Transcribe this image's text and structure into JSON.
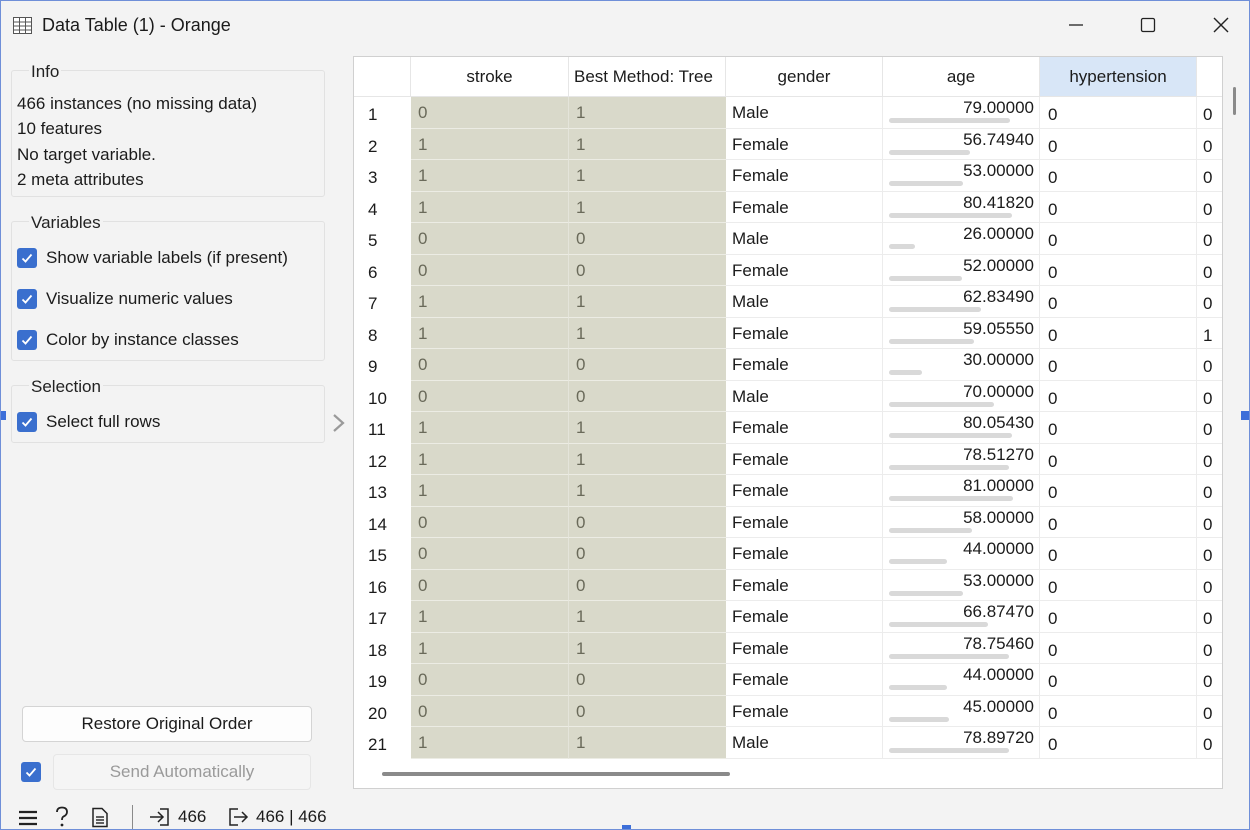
{
  "window": {
    "title": "Data Table (1) - Orange",
    "icon": "table-icon",
    "controls": [
      "minimize-icon",
      "maximize-icon",
      "close-icon"
    ]
  },
  "info": {
    "heading": "Info",
    "lines": [
      "466 instances (no missing data)",
      "10 features",
      "No target variable.",
      "2 meta attributes"
    ]
  },
  "variables": {
    "heading": "Variables",
    "options": [
      {
        "label": "Show variable labels (if present)",
        "checked": true
      },
      {
        "label": "Visualize numeric values",
        "checked": true
      },
      {
        "label": "Color by instance classes",
        "checked": true
      }
    ]
  },
  "selection": {
    "heading": "Selection",
    "options": [
      {
        "label": "Select full rows",
        "checked": true
      }
    ]
  },
  "buttons": {
    "restore": "Restore Original Order",
    "send": "Send Automatically",
    "send_auto_checked": true
  },
  "table": {
    "columns": [
      "stroke",
      "Best Method: Tree",
      "gender",
      "age",
      "hypertension"
    ],
    "selected_column": "hypertension",
    "age_max": 82,
    "rows": [
      {
        "idx": "1",
        "stroke": "0",
        "best": "1",
        "gender": "Male",
        "age": "79.00000",
        "hyp": "0",
        "next": "0"
      },
      {
        "idx": "2",
        "stroke": "1",
        "best": "1",
        "gender": "Female",
        "age": "56.74940",
        "hyp": "0",
        "next": "0"
      },
      {
        "idx": "3",
        "stroke": "1",
        "best": "1",
        "gender": "Female",
        "age": "53.00000",
        "hyp": "0",
        "next": "0"
      },
      {
        "idx": "4",
        "stroke": "1",
        "best": "1",
        "gender": "Female",
        "age": "80.41820",
        "hyp": "0",
        "next": "0"
      },
      {
        "idx": "5",
        "stroke": "0",
        "best": "0",
        "gender": "Male",
        "age": "26.00000",
        "hyp": "0",
        "next": "0"
      },
      {
        "idx": "6",
        "stroke": "0",
        "best": "0",
        "gender": "Female",
        "age": "52.00000",
        "hyp": "0",
        "next": "0"
      },
      {
        "idx": "7",
        "stroke": "1",
        "best": "1",
        "gender": "Male",
        "age": "62.83490",
        "hyp": "0",
        "next": "0"
      },
      {
        "idx": "8",
        "stroke": "1",
        "best": "1",
        "gender": "Female",
        "age": "59.05550",
        "hyp": "0",
        "next": "1"
      },
      {
        "idx": "9",
        "stroke": "0",
        "best": "0",
        "gender": "Female",
        "age": "30.00000",
        "hyp": "0",
        "next": "0"
      },
      {
        "idx": "10",
        "stroke": "0",
        "best": "0",
        "gender": "Male",
        "age": "70.00000",
        "hyp": "0",
        "next": "0"
      },
      {
        "idx": "11",
        "stroke": "1",
        "best": "1",
        "gender": "Female",
        "age": "80.05430",
        "hyp": "0",
        "next": "0"
      },
      {
        "idx": "12",
        "stroke": "1",
        "best": "1",
        "gender": "Female",
        "age": "78.51270",
        "hyp": "0",
        "next": "0"
      },
      {
        "idx": "13",
        "stroke": "1",
        "best": "1",
        "gender": "Female",
        "age": "81.00000",
        "hyp": "0",
        "next": "0"
      },
      {
        "idx": "14",
        "stroke": "0",
        "best": "0",
        "gender": "Female",
        "age": "58.00000",
        "hyp": "0",
        "next": "0"
      },
      {
        "idx": "15",
        "stroke": "0",
        "best": "0",
        "gender": "Female",
        "age": "44.00000",
        "hyp": "0",
        "next": "0"
      },
      {
        "idx": "16",
        "stroke": "0",
        "best": "0",
        "gender": "Female",
        "age": "53.00000",
        "hyp": "0",
        "next": "0"
      },
      {
        "idx": "17",
        "stroke": "1",
        "best": "1",
        "gender": "Female",
        "age": "66.87470",
        "hyp": "0",
        "next": "0"
      },
      {
        "idx": "18",
        "stroke": "1",
        "best": "1",
        "gender": "Female",
        "age": "78.75460",
        "hyp": "0",
        "next": "0"
      },
      {
        "idx": "19",
        "stroke": "0",
        "best": "0",
        "gender": "Female",
        "age": "44.00000",
        "hyp": "0",
        "next": "0"
      },
      {
        "idx": "20",
        "stroke": "0",
        "best": "0",
        "gender": "Female",
        "age": "45.00000",
        "hyp": "0",
        "next": "0"
      },
      {
        "idx": "21",
        "stroke": "1",
        "best": "1",
        "gender": "Male",
        "age": "78.89720",
        "hyp": "0",
        "next": "0"
      }
    ]
  },
  "status": {
    "input_count": "466",
    "output_count": "466 | 466",
    "icons": [
      "menu-icon",
      "help-icon",
      "report-icon",
      "input-icon",
      "output-icon"
    ]
  },
  "colors": {
    "accent": "#3a6fce",
    "class_cell": "#d9d9ca",
    "selected_header": "#d8e6f7",
    "age_bar": "#d9d9d9"
  }
}
